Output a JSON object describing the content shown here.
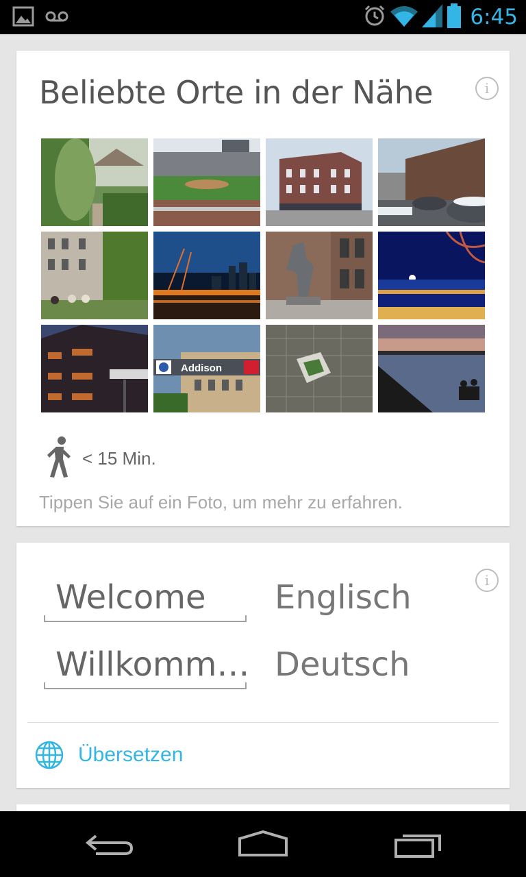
{
  "status_bar": {
    "time": "6:45",
    "left_icons": [
      "picture-icon",
      "voicemail-icon"
    ],
    "right_icons": [
      "alarm-icon",
      "wifi-icon",
      "signal-icon",
      "battery-icon"
    ],
    "accent_color": "#33b5e5"
  },
  "places_card": {
    "title": "Beliebte Orte in der Nähe",
    "photos": [
      {
        "name": "photo-ivy-garden"
      },
      {
        "name": "photo-baseball-stadium"
      },
      {
        "name": "photo-brick-corner-building"
      },
      {
        "name": "photo-snowy-street"
      },
      {
        "name": "photo-greystone-street"
      },
      {
        "name": "photo-harbor-night"
      },
      {
        "name": "photo-statue"
      },
      {
        "name": "photo-lake-moonlight"
      },
      {
        "name": "photo-modern-building-dusk"
      },
      {
        "name": "photo-addison-station",
        "sign": "Addison"
      },
      {
        "name": "photo-aerial-stadium"
      },
      {
        "name": "photo-lakefront-sunset"
      }
    ],
    "walk_time": "< 15 Min.",
    "hint": "Tippen Sie auf ein Foto, um mehr zu erfahren."
  },
  "translate_card": {
    "source_text": "Welcome",
    "source_language": "Englisch",
    "target_text": "Willkomm…",
    "target_language": "Deutsch",
    "action_label": "Übersetzen"
  },
  "nav_bar": {
    "buttons": [
      "back-icon",
      "home-icon",
      "recent-apps-icon"
    ]
  }
}
